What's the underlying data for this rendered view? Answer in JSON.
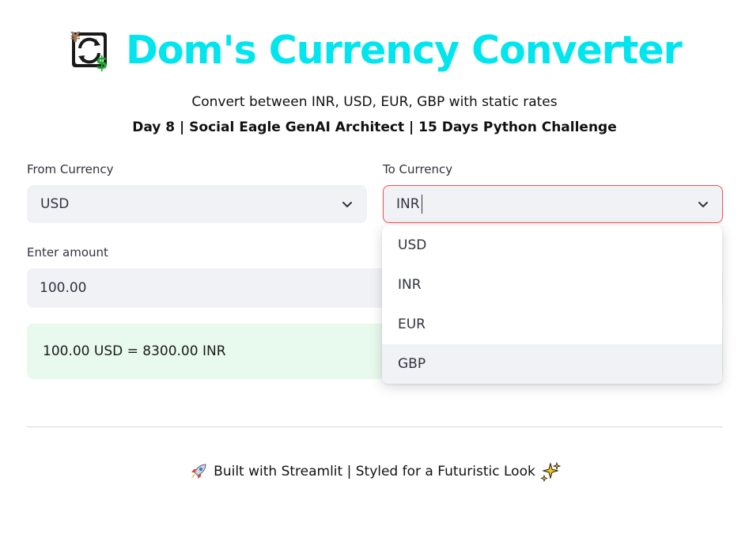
{
  "header": {
    "title": "Dom's Currency Converter",
    "logo_icon": "currency-exchange-icon",
    "subtitle": "Convert between INR, USD, EUR, GBP with static rates",
    "tagline": "Day 8 | Social Eagle GenAI Architect | 15 Days Python Challenge"
  },
  "form": {
    "from_label": "From Currency",
    "from_value": "USD",
    "to_label": "To Currency",
    "to_value": "INR",
    "amount_label": "Enter amount",
    "amount_value": "100.00"
  },
  "dropdown": {
    "options": [
      "USD",
      "INR",
      "EUR",
      "GBP"
    ],
    "highlighted": "GBP"
  },
  "result": {
    "text": "100.00 USD = 8300.00 INR"
  },
  "footer": {
    "text": "Built with Streamlit | Styled for a Futuristic Look",
    "left_icon": "rocket-icon",
    "right_icon": "sparkles-icon"
  },
  "colors": {
    "title": "#00e5ee",
    "focus_border": "#ff4b4b",
    "input_bg": "#f0f2f6",
    "success_bg": "#e8f9ee"
  }
}
